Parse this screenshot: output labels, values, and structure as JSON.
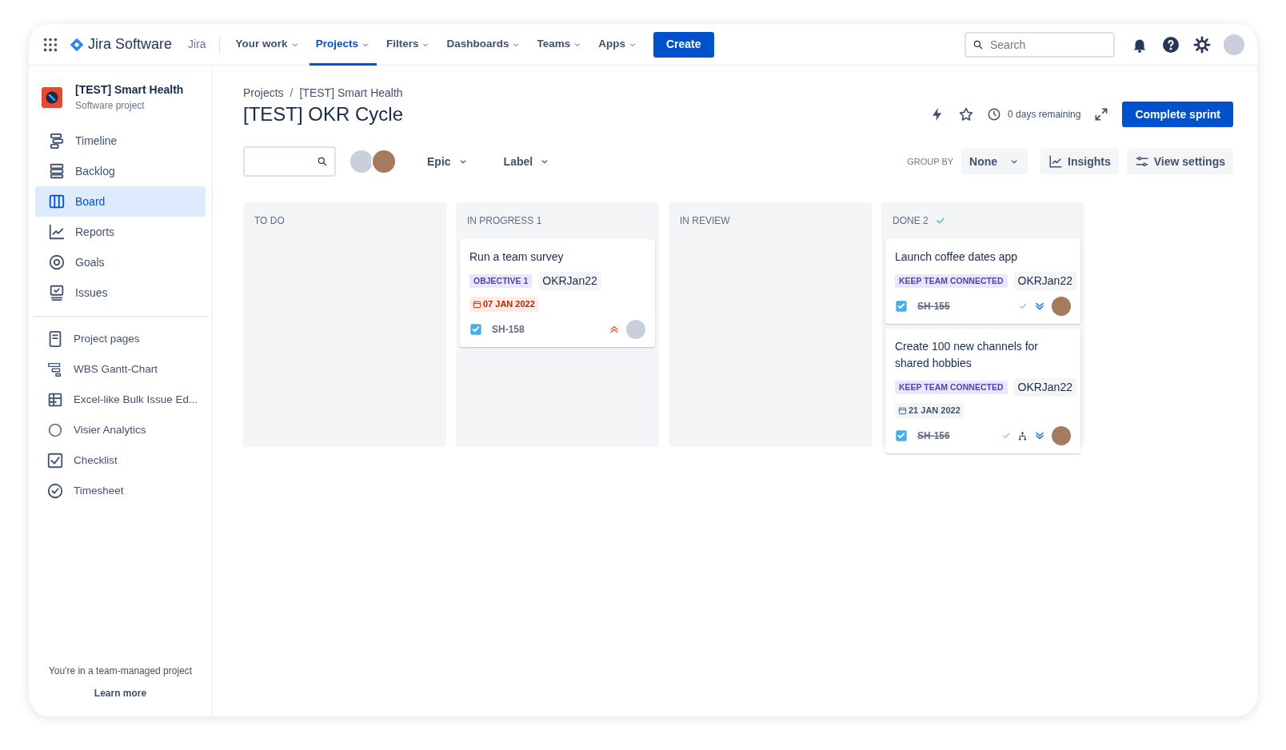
{
  "topbar": {
    "product": "Jira Software",
    "site": "Jira",
    "nav": [
      {
        "label": "Your work",
        "selected": false
      },
      {
        "label": "Projects",
        "selected": true
      },
      {
        "label": "Filters",
        "selected": false
      },
      {
        "label": "Dashboards",
        "selected": false
      },
      {
        "label": "Teams",
        "selected": false
      },
      {
        "label": "Apps",
        "selected": false
      }
    ],
    "create": "Create",
    "search": {
      "placeholder": "Search"
    }
  },
  "sidebar": {
    "project": {
      "name": "[TEST] Smart Health",
      "type": "Software project"
    },
    "planning": [
      {
        "label": "Timeline",
        "selected": false
      },
      {
        "label": "Backlog",
        "selected": false
      },
      {
        "label": "Board",
        "selected": true
      },
      {
        "label": "Reports",
        "selected": false
      },
      {
        "label": "Goals",
        "selected": false
      },
      {
        "label": "Issues",
        "selected": false
      }
    ],
    "apps": [
      {
        "label": "Project pages",
        "selected": false
      },
      {
        "label": "WBS Gantt-Chart",
        "selected": false
      },
      {
        "label": "Excel-like Bulk Issue Ed...",
        "selected": false
      },
      {
        "label": "Visier Analytics",
        "selected": false
      },
      {
        "label": "Checklist",
        "selected": false
      },
      {
        "label": "Timesheet",
        "selected": false
      }
    ],
    "footer": {
      "text": "You're in a team-managed project",
      "link": "Learn more"
    }
  },
  "breadcrumbs": [
    "Projects",
    "[TEST] Smart Health"
  ],
  "breadcrumb_separator": "/",
  "title": "[TEST] OKR Cycle",
  "sprint": {
    "remaining": "0 days remaining",
    "button": "Complete sprint"
  },
  "filters": {
    "epic": "Epic",
    "label": "Label",
    "group_by": "GROUP BY",
    "group_value": "None",
    "insights": "Insights",
    "view_settings": "View settings"
  },
  "columns": [
    {
      "title": "TO DO",
      "done": false
    },
    {
      "title": "IN PROGRESS",
      "count": "1",
      "done": false,
      "cards": [
        {
          "title": "Run a team survey",
          "epic": "OBJECTIVE 1",
          "label": "OKRJan22",
          "due": {
            "text": "07 JAN 2022",
            "overdue": true
          },
          "key": "SH-158",
          "resolved": false,
          "priority_high": true,
          "has_children": false
        }
      ]
    },
    {
      "title": "IN REVIEW",
      "done": false
    },
    {
      "title": "DONE",
      "count": "2",
      "done": true,
      "cards": [
        {
          "title": "Launch coffee dates app",
          "epic": "KEEP TEAM CONNECTED",
          "label": "OKRJan22",
          "key": "SH-155",
          "resolved": true,
          "priority_high": false,
          "has_children": false
        },
        {
          "title": "Create 100 new channels for shared hobbies",
          "epic": "KEEP TEAM CONNECTED",
          "label": "OKRJan22",
          "due": {
            "text": "21 JAN 2022",
            "overdue": false
          },
          "key": "SH-156",
          "resolved": true,
          "priority_high": false,
          "has_children": true
        }
      ]
    }
  ]
}
